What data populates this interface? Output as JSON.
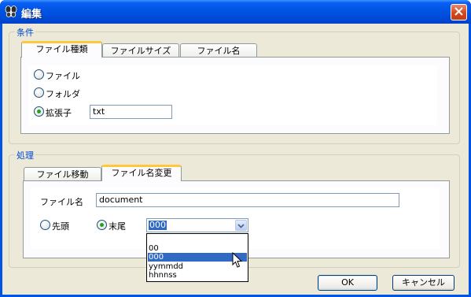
{
  "window": {
    "title": "編集",
    "title_icon": "butterfly-icon",
    "close_icon": "close-icon"
  },
  "conditions": {
    "group_label": "条件",
    "tabs": [
      {
        "label": "ファイル種類",
        "active": true
      },
      {
        "label": "ファイルサイズ",
        "active": false
      },
      {
        "label": "ファイル名",
        "active": false
      }
    ],
    "options": [
      {
        "label": "ファイル",
        "checked": false
      },
      {
        "label": "フォルダ",
        "checked": false
      },
      {
        "label": "拡張子",
        "checked": true
      }
    ],
    "extension_value": "txt"
  },
  "processing": {
    "group_label": "処理",
    "tabs": [
      {
        "label": "ファイル移動",
        "active": false
      },
      {
        "label": "ファイル名変更",
        "active": true
      }
    ],
    "filename_label": "ファイル名",
    "filename_value": "document",
    "position_options": [
      {
        "label": "先頭",
        "checked": false
      },
      {
        "label": "末尾",
        "checked": true
      }
    ],
    "format_select": {
      "selected": "000",
      "options": [
        "",
        "00",
        "000",
        "yymmdd",
        "hhnnss"
      ],
      "highlighted": "000"
    }
  },
  "buttons": {
    "ok": "OK",
    "cancel": "キャンセル"
  },
  "colors": {
    "titlebar": "#0054e3",
    "group_label": "#0046d5",
    "active_tab_accent": "#ffc83c",
    "selection": "#316ac5",
    "radio_dot": "#21a121"
  }
}
